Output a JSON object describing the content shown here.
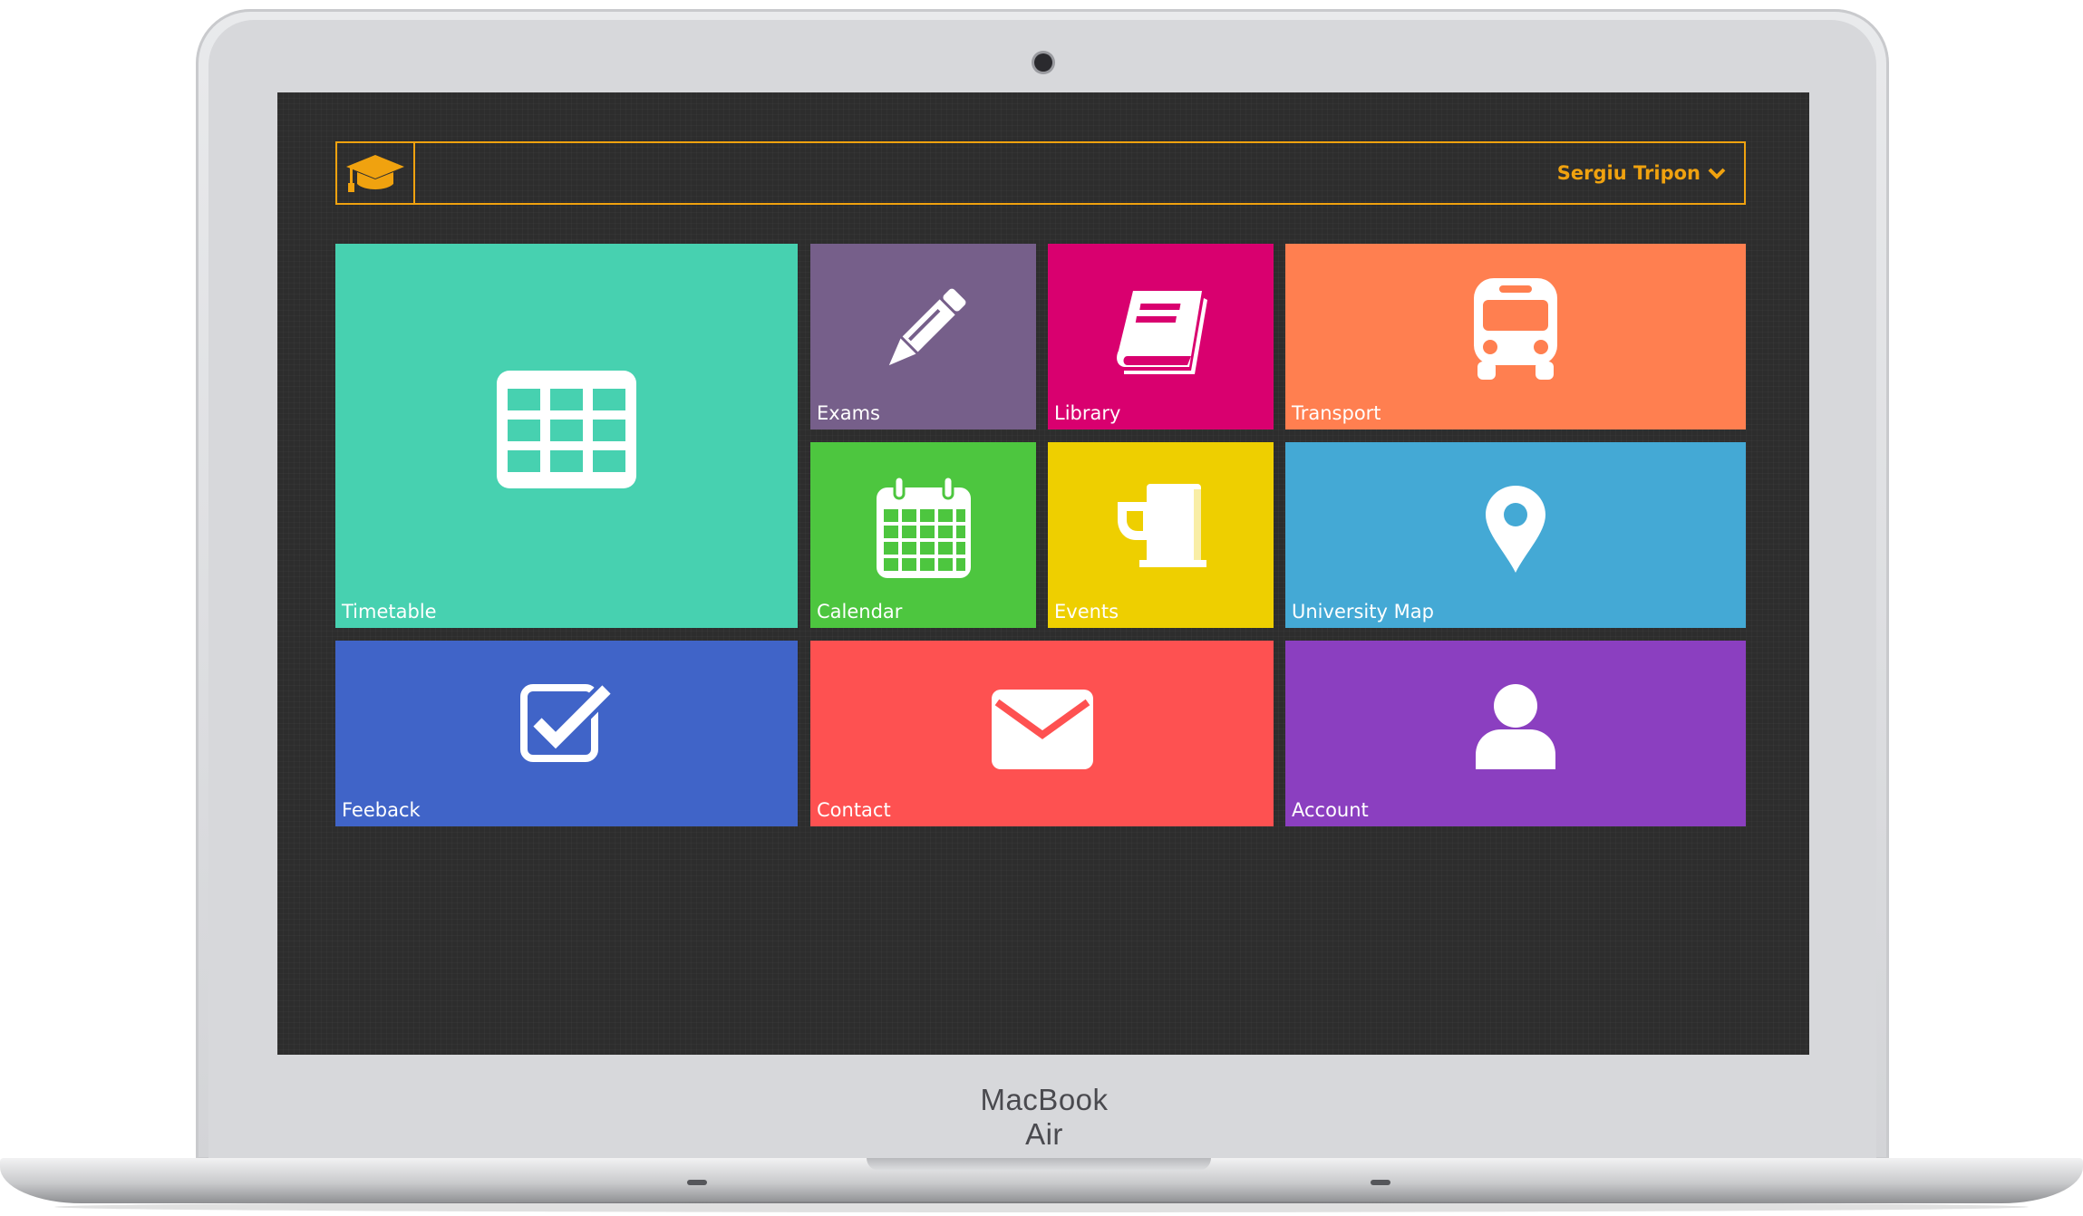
{
  "device": {
    "brand": "MacBook Air"
  },
  "header": {
    "user_name": "Sergiu Tripon"
  },
  "colors": {
    "accent": "#f0a20f"
  },
  "tiles": [
    {
      "label": "Timetable",
      "icon": "timetable-icon",
      "color": "#47d1b0"
    },
    {
      "label": "Exams",
      "icon": "pencil-icon",
      "color": "#765f8a"
    },
    {
      "label": "Library",
      "icon": "book-icon",
      "color": "#d9006f"
    },
    {
      "label": "Transport",
      "icon": "bus-icon",
      "color": "#ff7f50"
    },
    {
      "label": "Calendar",
      "icon": "calendar-icon",
      "color": "#4dc63f"
    },
    {
      "label": "Events",
      "icon": "beer-mug-icon",
      "color": "#eecf00"
    },
    {
      "label": "University Map",
      "icon": "map-pin-icon",
      "color": "#44a9d5"
    },
    {
      "label": "Feeback",
      "icon": "checkbox-icon",
      "color": "#4064c8"
    },
    {
      "label": "Contact",
      "icon": "envelope-icon",
      "color": "#fe5151"
    },
    {
      "label": "Account",
      "icon": "user-icon",
      "color": "#8b3fc0"
    }
  ]
}
